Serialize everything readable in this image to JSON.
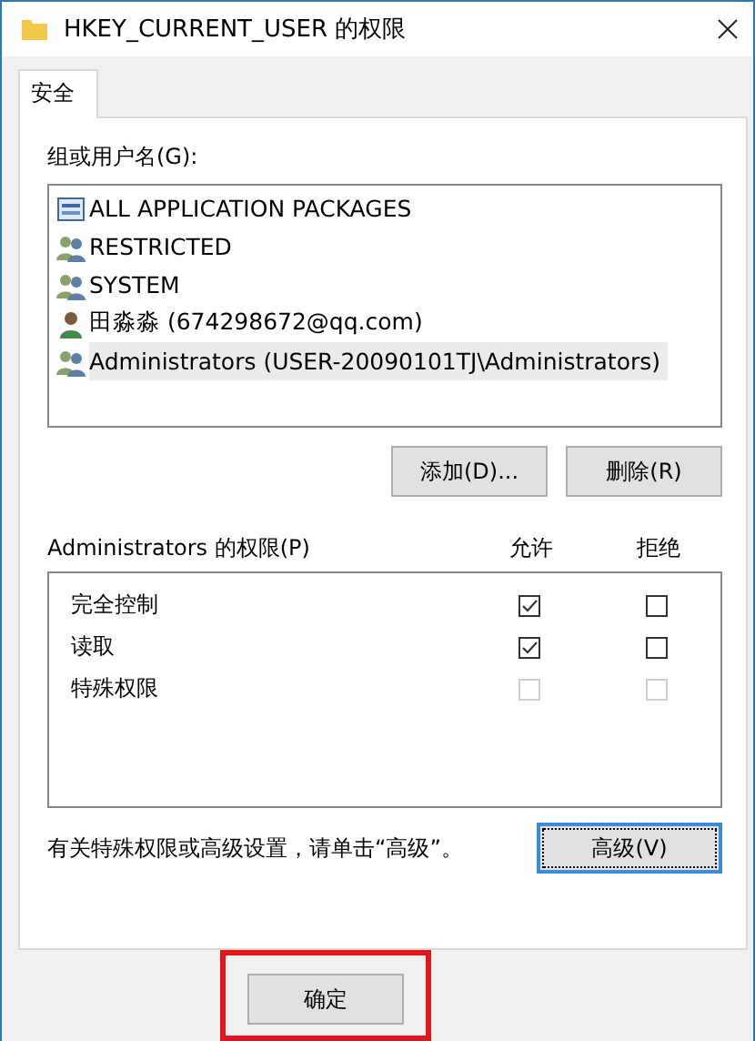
{
  "window": {
    "title": "HKEY_CURRENT_USER 的权限"
  },
  "tabs": [
    {
      "label": "安全",
      "selected": true
    }
  ],
  "groups": {
    "label": "组或用户名(G):",
    "items": [
      {
        "kind": "package",
        "name": "ALL APPLICATION PACKAGES",
        "selected": false
      },
      {
        "kind": "group",
        "name": "RESTRICTED",
        "selected": false
      },
      {
        "kind": "group",
        "name": "SYSTEM",
        "selected": false
      },
      {
        "kind": "user",
        "name": "田淼淼 (674298672@qq.com)",
        "selected": false
      },
      {
        "kind": "group",
        "name": "Administrators (USER-20090101TJ\\Administrators)",
        "selected": true
      }
    ]
  },
  "group_buttons": [
    "添加(D)...",
    "删除(R)"
  ],
  "permissions": {
    "label": "Administrators 的权限(P)",
    "allow_header": "允许",
    "deny_header": "拒绝",
    "rows": [
      {
        "name": "完全控制",
        "allow": {
          "checked": true,
          "disabled": false
        },
        "deny": {
          "checked": false,
          "disabled": false
        }
      },
      {
        "name": "读取",
        "allow": {
          "checked": true,
          "disabled": false
        },
        "deny": {
          "checked": false,
          "disabled": false
        }
      },
      {
        "name": "特殊权限",
        "allow": {
          "checked": false,
          "disabled": true
        },
        "deny": {
          "checked": false,
          "disabled": true
        }
      }
    ]
  },
  "advanced": {
    "hint": "有关特殊权限或高级设置，请单击“高级”。",
    "button": "高级(V)",
    "focused": true
  },
  "footer": {
    "ok_button": "确定",
    "highlighted": true
  }
}
